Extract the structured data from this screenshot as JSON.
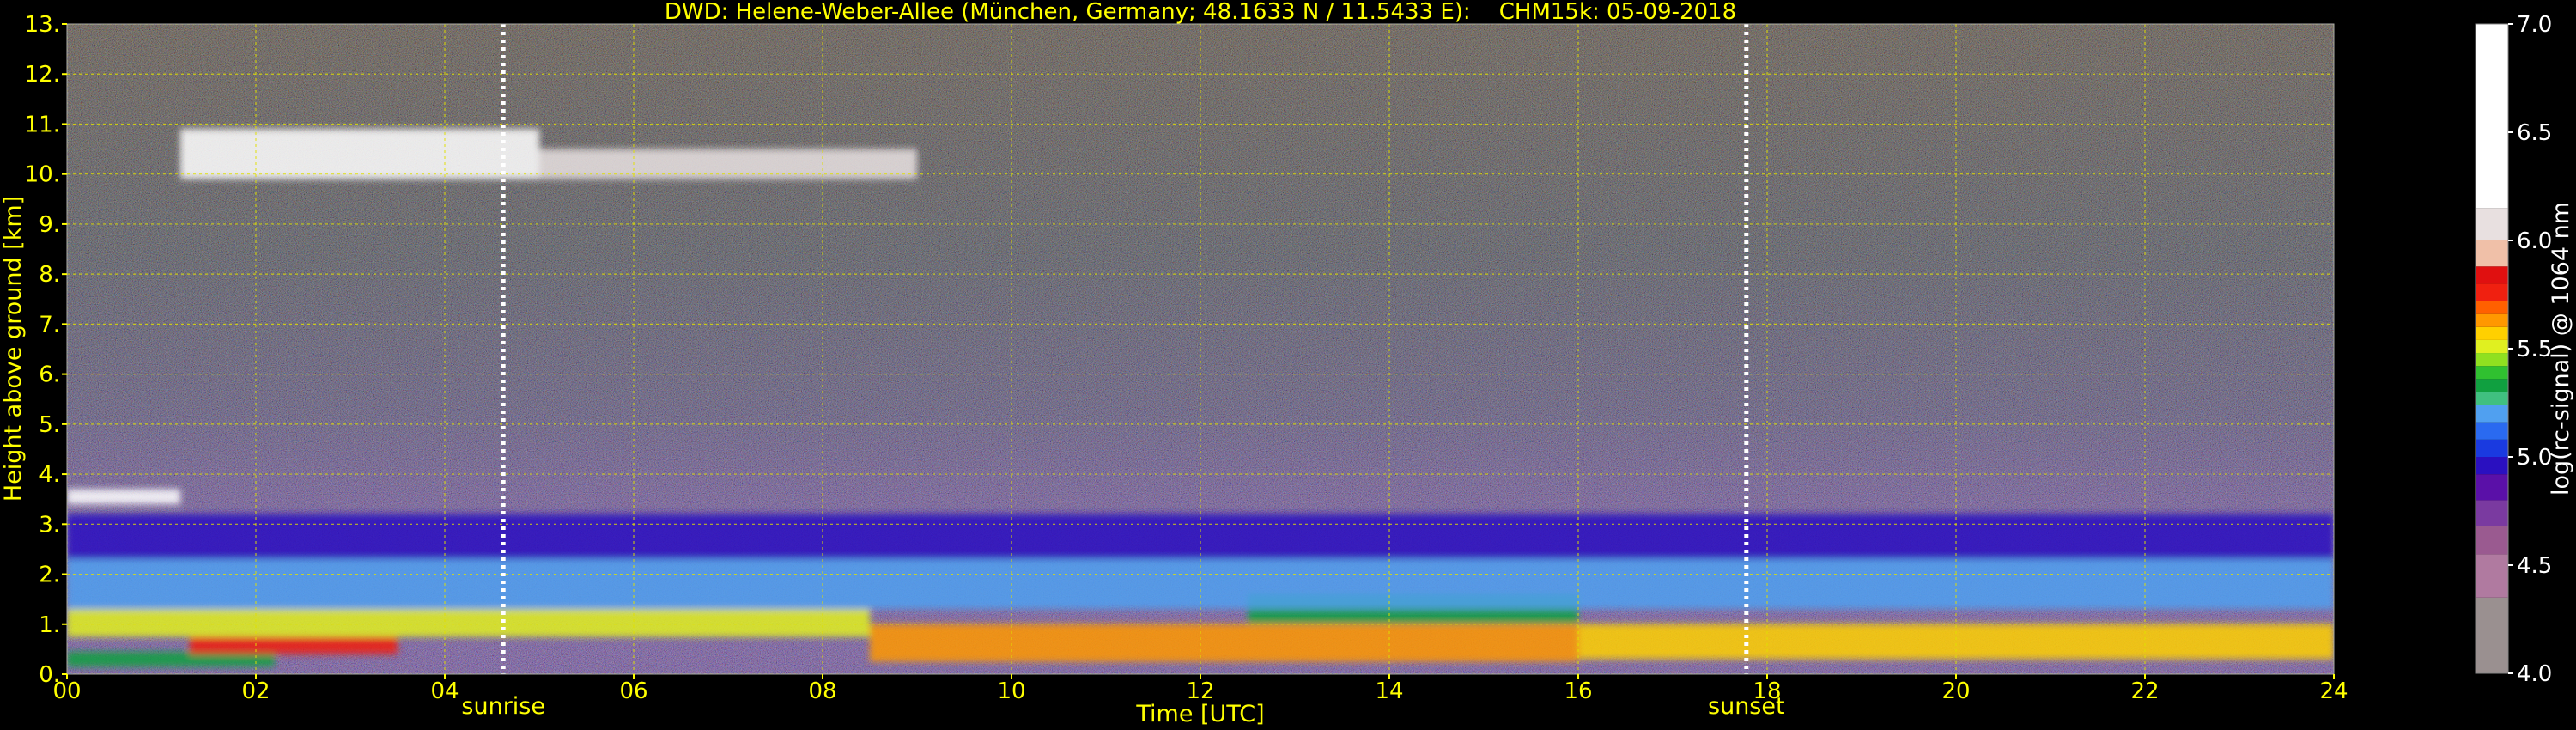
{
  "chart_data": {
    "type": "heatmap",
    "title": "DWD: Helene-Weber-Allee (München, Germany; 48.1633 N / 11.5433 E):    CHM15k: 05-09-2018",
    "xlabel": "Time [UTC]",
    "ylabel": "Height above ground [km]",
    "xlim": [
      0,
      24
    ],
    "ylim": [
      0,
      13
    ],
    "x_ticks": [
      {
        "value": 0,
        "label": "00"
      },
      {
        "value": 2,
        "label": "02"
      },
      {
        "value": 4,
        "label": "04"
      },
      {
        "value": 6,
        "label": "06"
      },
      {
        "value": 8,
        "label": "08"
      },
      {
        "value": 10,
        "label": "10"
      },
      {
        "value": 12,
        "label": "12"
      },
      {
        "value": 14,
        "label": "14"
      },
      {
        "value": 16,
        "label": "16"
      },
      {
        "value": 18,
        "label": "18"
      },
      {
        "value": 20,
        "label": "20"
      },
      {
        "value": 22,
        "label": "22"
      },
      {
        "value": 24,
        "label": "24"
      }
    ],
    "y_ticks": [
      {
        "value": 0,
        "label": "0."
      },
      {
        "value": 1,
        "label": "1."
      },
      {
        "value": 2,
        "label": "2."
      },
      {
        "value": 3,
        "label": "3."
      },
      {
        "value": 4,
        "label": "4."
      },
      {
        "value": 5,
        "label": "5."
      },
      {
        "value": 6,
        "label": "6."
      },
      {
        "value": 7,
        "label": "7."
      },
      {
        "value": 8,
        "label": "8."
      },
      {
        "value": 9,
        "label": "9."
      },
      {
        "value": 10,
        "label": "10."
      },
      {
        "value": 11,
        "label": "11."
      },
      {
        "value": 12,
        "label": "12."
      },
      {
        "value": 13,
        "label": "13."
      }
    ],
    "grid": true,
    "markers": [
      {
        "label": "sunrise",
        "x": 4.62
      },
      {
        "label": "sunset",
        "x": 17.78
      }
    ],
    "colorbar": {
      "label": "log(rc-signal) @ 1064 nm",
      "range": [
        4.0,
        7.0
      ],
      "ticks": [
        {
          "value": 4.0,
          "label": "4.0"
        },
        {
          "value": 4.5,
          "label": "4.5"
        },
        {
          "value": 5.0,
          "label": "5.0"
        },
        {
          "value": 5.5,
          "label": "5.5"
        },
        {
          "value": 6.0,
          "label": "6.0"
        },
        {
          "value": 6.5,
          "label": "6.5"
        },
        {
          "value": 7.0,
          "label": "7.0"
        }
      ],
      "bands": [
        {
          "from": 4.0,
          "to": 4.35,
          "color": "#9a9090"
        },
        {
          "from": 4.35,
          "to": 4.55,
          "color": "#b07aa0"
        },
        {
          "from": 4.55,
          "to": 4.68,
          "color": "#9a5a90"
        },
        {
          "from": 4.68,
          "to": 4.8,
          "color": "#7a3aa0"
        },
        {
          "from": 4.8,
          "to": 4.92,
          "color": "#5a10a8"
        },
        {
          "from": 4.92,
          "to": 5.0,
          "color": "#2a10c0"
        },
        {
          "from": 5.0,
          "to": 5.08,
          "color": "#1a3ae0"
        },
        {
          "from": 5.08,
          "to": 5.16,
          "color": "#2a6af0"
        },
        {
          "from": 5.16,
          "to": 5.24,
          "color": "#50a0f0"
        },
        {
          "from": 5.24,
          "to": 5.3,
          "color": "#40c080"
        },
        {
          "from": 5.3,
          "to": 5.36,
          "color": "#10a040"
        },
        {
          "from": 5.36,
          "to": 5.42,
          "color": "#30c030"
        },
        {
          "from": 5.42,
          "to": 5.48,
          "color": "#90e020"
        },
        {
          "from": 5.48,
          "to": 5.54,
          "color": "#e0f020"
        },
        {
          "from": 5.54,
          "to": 5.6,
          "color": "#ffd000"
        },
        {
          "from": 5.6,
          "to": 5.66,
          "color": "#ff9800"
        },
        {
          "from": 5.66,
          "to": 5.72,
          "color": "#ff6000"
        },
        {
          "from": 5.72,
          "to": 5.8,
          "color": "#f02010"
        },
        {
          "from": 5.8,
          "to": 5.88,
          "color": "#e01010"
        },
        {
          "from": 5.88,
          "to": 6.0,
          "color": "#f0c0a8"
        },
        {
          "from": 6.0,
          "to": 6.15,
          "color": "#e8e0e0"
        },
        {
          "from": 6.15,
          "to": 7.0,
          "color": "#ffffff"
        }
      ]
    },
    "series": [
      {
        "values": [
          {
            "x0": 0,
            "x1": 2.2,
            "y0": 0.15,
            "y1": 0.45,
            "v": 5.33
          },
          {
            "x0": 1.3,
            "x1": 3.5,
            "y0": 0.4,
            "y1": 0.75,
            "v": 5.78
          },
          {
            "x0": 0,
            "x1": 8.5,
            "y0": 0.75,
            "y1": 1.3,
            "v": 5.48
          },
          {
            "x0": 8.5,
            "x1": 16,
            "y0": 0.25,
            "y1": 1.0,
            "v": 5.65
          },
          {
            "x0": 16,
            "x1": 24,
            "y0": 0.3,
            "y1": 1.0,
            "v": 5.57
          },
          {
            "x0": 12.5,
            "x1": 16,
            "y0": 1.0,
            "y1": 1.6,
            "v": 5.33
          },
          {
            "x0": 0,
            "x1": 24,
            "y0": 1.3,
            "y1": 2.3,
            "v": 5.2
          },
          {
            "x0": 0,
            "x1": 24,
            "y0": 2.3,
            "y1": 3.2,
            "v": 4.95
          },
          {
            "x0": 0,
            "x1": 1.2,
            "y0": 3.4,
            "y1": 3.7,
            "v": 6.5
          },
          {
            "x0": 1.2,
            "x1": 5.0,
            "y0": 9.9,
            "y1": 10.9,
            "v": 6.4
          },
          {
            "x0": 5.0,
            "x1": 9.0,
            "y0": 9.9,
            "y1": 10.5,
            "v": 6.1
          }
        ]
      }
    ]
  }
}
